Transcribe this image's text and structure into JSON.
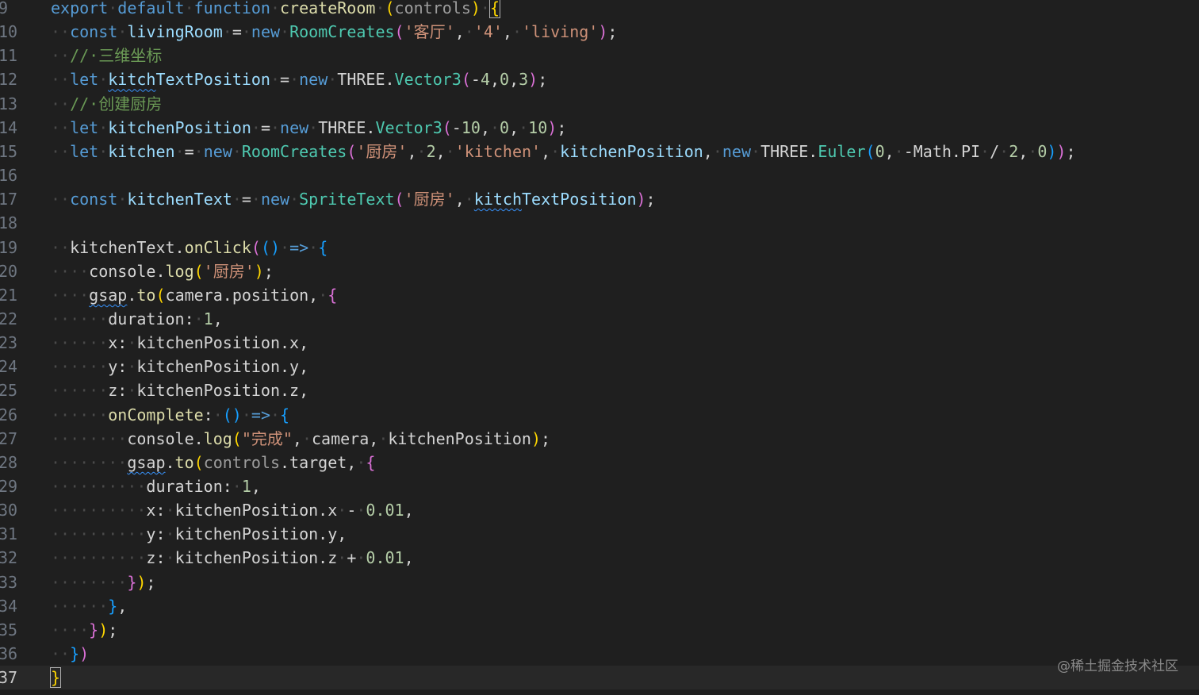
{
  "editor": {
    "lines": [
      {
        "n": "9",
        "segs": [
          [
            "kw",
            "export"
          ],
          [
            "ws",
            "·"
          ],
          [
            "kw",
            "default"
          ],
          [
            "ws",
            "·"
          ],
          [
            "kw",
            "function"
          ],
          [
            "ws",
            "·"
          ],
          [
            "fn",
            "createRoom"
          ],
          [
            "ws",
            "·"
          ],
          [
            "b1",
            "("
          ],
          [
            "prm",
            "controls"
          ],
          [
            "b1",
            ")"
          ],
          [
            "ws",
            "·"
          ],
          [
            "b1 bm",
            "{"
          ]
        ]
      },
      {
        "n": "10",
        "segs": [
          [
            "ws",
            "··"
          ],
          [
            "kw",
            "const"
          ],
          [
            "ws",
            "·"
          ],
          [
            "var",
            "livingRoom"
          ],
          [
            "ws",
            "·"
          ],
          [
            "pl",
            "="
          ],
          [
            "ws",
            "·"
          ],
          [
            "kw",
            "new"
          ],
          [
            "ws",
            "·"
          ],
          [
            "cls",
            "RoomCreates"
          ],
          [
            "b2",
            "("
          ],
          [
            "str",
            "'客厅'"
          ],
          [
            "pl",
            ","
          ],
          [
            "ws",
            "·"
          ],
          [
            "str",
            "'4'"
          ],
          [
            "pl",
            ","
          ],
          [
            "ws",
            "·"
          ],
          [
            "str",
            "'living'"
          ],
          [
            "b2",
            ")"
          ],
          [
            "pl",
            ";"
          ]
        ]
      },
      {
        "n": "11",
        "segs": [
          [
            "ws",
            "··"
          ],
          [
            "cm",
            "//·三维坐标"
          ]
        ]
      },
      {
        "n": "12",
        "segs": [
          [
            "ws",
            "··"
          ],
          [
            "kw",
            "let"
          ],
          [
            "ws",
            "·"
          ],
          [
            "var sq",
            "kitch"
          ],
          [
            "var",
            "TextPosition"
          ],
          [
            "ws",
            "·"
          ],
          [
            "pl",
            "="
          ],
          [
            "ws",
            "·"
          ],
          [
            "kw",
            "new"
          ],
          [
            "ws",
            "·"
          ],
          [
            "pl",
            "THREE."
          ],
          [
            "cls",
            "Vector3"
          ],
          [
            "b2",
            "("
          ],
          [
            "pl",
            "-"
          ],
          [
            "num",
            "4"
          ],
          [
            "pl",
            ","
          ],
          [
            "num",
            "0"
          ],
          [
            "pl",
            ","
          ],
          [
            "num",
            "3"
          ],
          [
            "b2",
            ")"
          ],
          [
            "pl",
            ";"
          ]
        ]
      },
      {
        "n": "13",
        "segs": [
          [
            "ws",
            "··"
          ],
          [
            "cm",
            "//·创建厨房"
          ]
        ]
      },
      {
        "n": "14",
        "segs": [
          [
            "ws",
            "··"
          ],
          [
            "kw",
            "let"
          ],
          [
            "ws",
            "·"
          ],
          [
            "var",
            "kitchenPosition"
          ],
          [
            "ws",
            "·"
          ],
          [
            "pl",
            "="
          ],
          [
            "ws",
            "·"
          ],
          [
            "kw",
            "new"
          ],
          [
            "ws",
            "·"
          ],
          [
            "pl",
            "THREE."
          ],
          [
            "cls",
            "Vector3"
          ],
          [
            "b2",
            "("
          ],
          [
            "pl",
            "-"
          ],
          [
            "num",
            "10"
          ],
          [
            "pl",
            ","
          ],
          [
            "ws",
            "·"
          ],
          [
            "num",
            "0"
          ],
          [
            "pl",
            ","
          ],
          [
            "ws",
            "·"
          ],
          [
            "num",
            "10"
          ],
          [
            "b2",
            ")"
          ],
          [
            "pl",
            ";"
          ]
        ]
      },
      {
        "n": "15",
        "segs": [
          [
            "ws",
            "··"
          ],
          [
            "kw",
            "let"
          ],
          [
            "ws",
            "·"
          ],
          [
            "var",
            "kitchen"
          ],
          [
            "ws",
            "·"
          ],
          [
            "pl",
            "="
          ],
          [
            "ws",
            "·"
          ],
          [
            "kw",
            "new"
          ],
          [
            "ws",
            "·"
          ],
          [
            "cls",
            "RoomCreates"
          ],
          [
            "b2",
            "("
          ],
          [
            "str",
            "'厨房'"
          ],
          [
            "pl",
            ","
          ],
          [
            "ws",
            "·"
          ],
          [
            "num",
            "2"
          ],
          [
            "pl",
            ","
          ],
          [
            "ws",
            "·"
          ],
          [
            "str",
            "'kitchen'"
          ],
          [
            "pl",
            ","
          ],
          [
            "ws",
            "·"
          ],
          [
            "var",
            "kitchenPosition"
          ],
          [
            "pl",
            ","
          ],
          [
            "ws",
            "·"
          ],
          [
            "kw",
            "new"
          ],
          [
            "ws",
            "·"
          ],
          [
            "pl",
            "THREE."
          ],
          [
            "cls",
            "Euler"
          ],
          [
            "b3",
            "("
          ],
          [
            "num",
            "0"
          ],
          [
            "pl",
            ","
          ],
          [
            "ws",
            "·"
          ],
          [
            "pl",
            "-Math.PI"
          ],
          [
            "ws",
            "·"
          ],
          [
            "pl",
            "/"
          ],
          [
            "ws",
            "·"
          ],
          [
            "num",
            "2"
          ],
          [
            "pl",
            ","
          ],
          [
            "ws",
            "·"
          ],
          [
            "num",
            "0"
          ],
          [
            "b3",
            ")"
          ],
          [
            "b2",
            ")"
          ],
          [
            "pl",
            ";"
          ]
        ]
      },
      {
        "n": "16",
        "segs": []
      },
      {
        "n": "17",
        "segs": [
          [
            "ws",
            "··"
          ],
          [
            "kw",
            "const"
          ],
          [
            "ws",
            "·"
          ],
          [
            "var",
            "kitchenText"
          ],
          [
            "ws",
            "·"
          ],
          [
            "pl",
            "="
          ],
          [
            "ws",
            "·"
          ],
          [
            "kw",
            "new"
          ],
          [
            "ws",
            "·"
          ],
          [
            "cls",
            "SpriteText"
          ],
          [
            "b2",
            "("
          ],
          [
            "str",
            "'厨房'"
          ],
          [
            "pl",
            ","
          ],
          [
            "ws",
            "·"
          ],
          [
            "var sq",
            "kitch"
          ],
          [
            "var",
            "TextPosition"
          ],
          [
            "b2",
            ")"
          ],
          [
            "pl",
            ";"
          ]
        ]
      },
      {
        "n": "18",
        "segs": []
      },
      {
        "n": "19",
        "segs": [
          [
            "ws",
            "··"
          ],
          [
            "pl",
            "kitchenText."
          ],
          [
            "fn",
            "onClick"
          ],
          [
            "b2",
            "("
          ],
          [
            "b3",
            "()"
          ],
          [
            "ws",
            "·"
          ],
          [
            "kw",
            "=>"
          ],
          [
            "ws",
            "·"
          ],
          [
            "b3",
            "{"
          ]
        ]
      },
      {
        "n": "20",
        "segs": [
          [
            "ws",
            "····"
          ],
          [
            "pl",
            "console."
          ],
          [
            "fn",
            "log"
          ],
          [
            "b1",
            "("
          ],
          [
            "str",
            "'厨房'"
          ],
          [
            "b1",
            ")"
          ],
          [
            "pl",
            ";"
          ]
        ]
      },
      {
        "n": "21",
        "segs": [
          [
            "ws",
            "····"
          ],
          [
            "pl sq",
            "gsap"
          ],
          [
            "pl",
            "."
          ],
          [
            "fn",
            "to"
          ],
          [
            "b1",
            "("
          ],
          [
            "pl",
            "camera.position,"
          ],
          [
            "ws",
            "·"
          ],
          [
            "b2",
            "{"
          ]
        ]
      },
      {
        "n": "22",
        "segs": [
          [
            "ws",
            "······"
          ],
          [
            "pl",
            "duration:"
          ],
          [
            "ws",
            "·"
          ],
          [
            "num",
            "1"
          ],
          [
            "pl",
            ","
          ]
        ]
      },
      {
        "n": "23",
        "segs": [
          [
            "ws",
            "······"
          ],
          [
            "pl",
            "x:"
          ],
          [
            "ws",
            "·"
          ],
          [
            "pl",
            "kitchenPosition.x,"
          ]
        ]
      },
      {
        "n": "24",
        "segs": [
          [
            "ws",
            "······"
          ],
          [
            "pl",
            "y:"
          ],
          [
            "ws",
            "·"
          ],
          [
            "pl",
            "kitchenPosition.y,"
          ]
        ]
      },
      {
        "n": "25",
        "segs": [
          [
            "ws",
            "······"
          ],
          [
            "pl",
            "z:"
          ],
          [
            "ws",
            "·"
          ],
          [
            "pl",
            "kitchenPosition.z,"
          ]
        ]
      },
      {
        "n": "26",
        "segs": [
          [
            "ws",
            "······"
          ],
          [
            "fn",
            "onComplete"
          ],
          [
            "pl",
            ":"
          ],
          [
            "ws",
            "·"
          ],
          [
            "b3",
            "()"
          ],
          [
            "ws",
            "·"
          ],
          [
            "kw",
            "=>"
          ],
          [
            "ws",
            "·"
          ],
          [
            "b3",
            "{"
          ]
        ]
      },
      {
        "n": "27",
        "segs": [
          [
            "ws",
            "········"
          ],
          [
            "pl",
            "console."
          ],
          [
            "fn",
            "log"
          ],
          [
            "b1",
            "("
          ],
          [
            "str",
            "\"完成\""
          ],
          [
            "pl",
            ","
          ],
          [
            "ws",
            "·"
          ],
          [
            "pl",
            "camera,"
          ],
          [
            "ws",
            "·"
          ],
          [
            "pl",
            "kitchenPosition"
          ],
          [
            "b1",
            ")"
          ],
          [
            "pl",
            ";"
          ]
        ]
      },
      {
        "n": "28",
        "segs": [
          [
            "ws",
            "········"
          ],
          [
            "pl sq",
            "gsap"
          ],
          [
            "pl",
            "."
          ],
          [
            "fn",
            "to"
          ],
          [
            "b1",
            "("
          ],
          [
            "prm",
            "controls"
          ],
          [
            "pl",
            ".target,"
          ],
          [
            "ws",
            "·"
          ],
          [
            "b2",
            "{"
          ]
        ]
      },
      {
        "n": "29",
        "segs": [
          [
            "ws",
            "··········"
          ],
          [
            "pl",
            "duration:"
          ],
          [
            "ws",
            "·"
          ],
          [
            "num",
            "1"
          ],
          [
            "pl",
            ","
          ]
        ]
      },
      {
        "n": "30",
        "segs": [
          [
            "ws",
            "··········"
          ],
          [
            "pl",
            "x:"
          ],
          [
            "ws",
            "·"
          ],
          [
            "pl",
            "kitchenPosition.x"
          ],
          [
            "ws",
            "·"
          ],
          [
            "pl",
            "-"
          ],
          [
            "ws",
            "·"
          ],
          [
            "num",
            "0.01"
          ],
          [
            "pl",
            ","
          ]
        ]
      },
      {
        "n": "31",
        "segs": [
          [
            "ws",
            "··········"
          ],
          [
            "pl",
            "y:"
          ],
          [
            "ws",
            "·"
          ],
          [
            "pl",
            "kitchenPosition.y,"
          ]
        ]
      },
      {
        "n": "32",
        "segs": [
          [
            "ws",
            "··········"
          ],
          [
            "pl",
            "z:"
          ],
          [
            "ws",
            "·"
          ],
          [
            "pl",
            "kitchenPosition.z"
          ],
          [
            "ws",
            "·"
          ],
          [
            "pl",
            "+"
          ],
          [
            "ws",
            "·"
          ],
          [
            "num",
            "0.01"
          ],
          [
            "pl",
            ","
          ]
        ]
      },
      {
        "n": "33",
        "segs": [
          [
            "ws",
            "········"
          ],
          [
            "b2",
            "}"
          ],
          [
            "b1",
            ")"
          ],
          [
            "pl",
            ";"
          ]
        ]
      },
      {
        "n": "34",
        "segs": [
          [
            "ws",
            "······"
          ],
          [
            "b3",
            "}"
          ],
          [
            "pl",
            ","
          ]
        ]
      },
      {
        "n": "35",
        "segs": [
          [
            "ws",
            "····"
          ],
          [
            "b2",
            "}"
          ],
          [
            "b1",
            ")"
          ],
          [
            "pl",
            ";"
          ]
        ]
      },
      {
        "n": "36",
        "segs": [
          [
            "ws",
            "··"
          ],
          [
            "b3",
            "}"
          ],
          [
            "b2",
            ")"
          ]
        ]
      },
      {
        "n": "37",
        "segs": [
          [
            "b1 bm",
            "}"
          ]
        ],
        "current": true
      }
    ]
  },
  "watermark": "@稀土掘金技术社区"
}
